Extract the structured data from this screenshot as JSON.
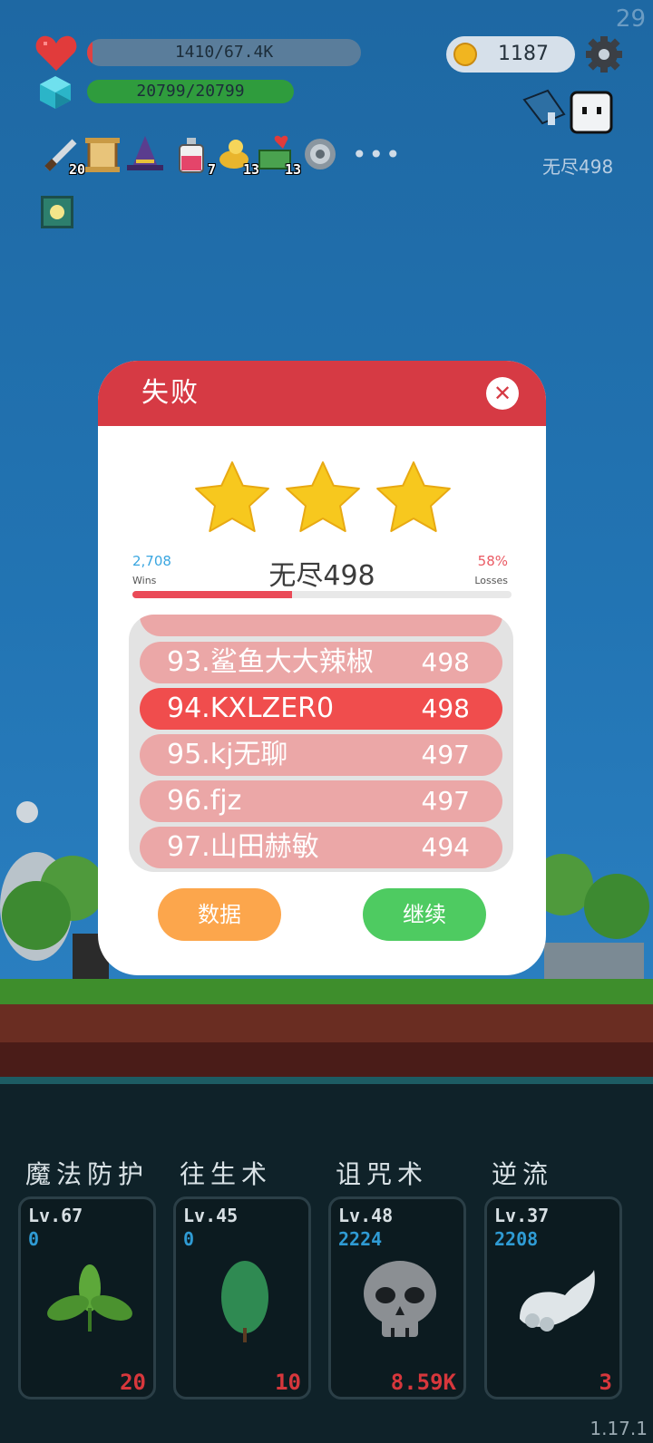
{
  "corner_number": "29",
  "hud": {
    "hp_text": "1410/67.4K",
    "hp_ratio": 0.021,
    "mp_text": "20799/20799",
    "mp_ratio": 1.0,
    "coins": "1187",
    "endless_label": "无尽498",
    "items": [
      {
        "name": "dagger-item-icon",
        "count": "20"
      },
      {
        "name": "scroll-item-icon",
        "count": ""
      },
      {
        "name": "wizard-hat-item-icon",
        "count": ""
      },
      {
        "name": "potion-item-icon",
        "count": "7"
      },
      {
        "name": "lamp-item-icon",
        "count": "13"
      },
      {
        "name": "cash-heart-item-icon",
        "count": "13"
      },
      {
        "name": "vortex-item-icon",
        "count": ""
      }
    ],
    "more": "•••"
  },
  "dialog": {
    "title": "失败",
    "close": "✕",
    "stars": 3,
    "wins_value": "2,708",
    "wins_label": "Wins",
    "losses_value": "58%",
    "losses_label": "Losses",
    "mode_title": "无尽498",
    "win_ratio": 0.42,
    "leaderboard": [
      {
        "name": "93.鲨鱼大大辣椒",
        "score": "498"
      },
      {
        "name": "94.KXLZER0",
        "score": "498",
        "me": true
      },
      {
        "name": "95.kj无聊",
        "score": "497"
      },
      {
        "name": "96.fjz",
        "score": "497"
      },
      {
        "name": "97.山田赫敏",
        "score": "494"
      }
    ],
    "btn_data": "数据",
    "btn_continue": "继续"
  },
  "skills": [
    {
      "title": "魔法防护",
      "level": "Lv.67",
      "value": "0",
      "cost": "20",
      "icon": "leaves-icon"
    },
    {
      "title": "往生术",
      "level": "Lv.45",
      "value": "0",
      "cost": "10",
      "icon": "leaf-icon"
    },
    {
      "title": "诅咒术",
      "level": "Lv.48",
      "value": "2224",
      "cost": "8.59K",
      "icon": "skull-icon"
    },
    {
      "title": "逆流",
      "level": "Lv.37",
      "value": "2208",
      "cost": "3",
      "icon": "wing-icon"
    }
  ],
  "version": "1.17.1"
}
